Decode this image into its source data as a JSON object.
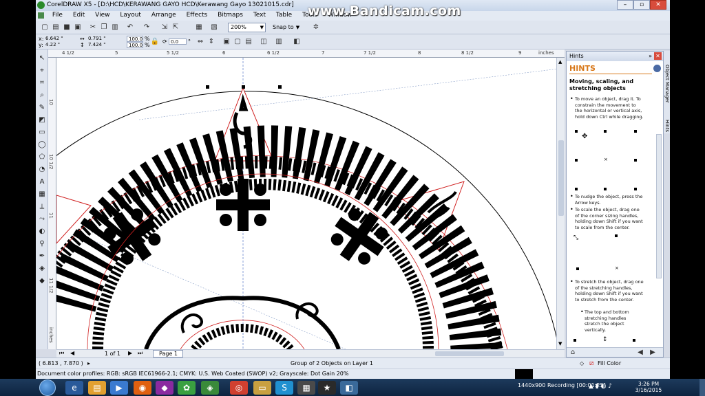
{
  "titlebar": {
    "app_title": "CorelDRAW X5 - [D:\\HCD\\KERAWANG GAYO HCD\\Kerawang Gayo 13021015.cdr]"
  },
  "menu": {
    "items": [
      "File",
      "Edit",
      "View",
      "Layout",
      "Arrange",
      "Effects",
      "Bitmaps",
      "Text",
      "Table",
      "Tools",
      "Window"
    ]
  },
  "toolbar": {
    "zoom": "200%",
    "snap_to": "Snap to"
  },
  "propbar": {
    "x": "6.642 \"",
    "y": "4.22 \"",
    "w": "0.791 \"",
    "h": "7.424 \"",
    "scale_x": "100.0",
    "scale_y": "100.0",
    "rotation": "0.0",
    "x_label": "x:",
    "y_label": "y:",
    "pct": "%",
    "deg": "°"
  },
  "ruler": {
    "h_ticks": [
      "4 1/2",
      "5",
      "5 1/2",
      "6",
      "6 1/2",
      "7",
      "7 1/2",
      "8",
      "8 1/2",
      "9"
    ],
    "units": "inches",
    "v_ticks": [
      "10",
      "10 1/2",
      "11",
      "11 1/2"
    ],
    "v_units": "inches"
  },
  "pagenav": {
    "page_counter": "1 of 1",
    "page_tab": "Page 1"
  },
  "status": {
    "coords": "( 6.813 , 7.870 )",
    "selection": "Group of 2 Objects on Layer 1",
    "color_profiles": "Document color profiles: RGB: sRGB IEC61966-2.1; CMYK: U.S. Web Coated (SWOP) v2; Grayscale: Dot Gain 20%",
    "fill_color": "Fill Color",
    "arrow": "▸"
  },
  "docker": {
    "title": "Hints",
    "hints_title": "HINTS",
    "heading": "Moving, scaling, and stretching objects",
    "hint_move": "To move an object, drag it. To constrain the movement to the horizontal or vertical axis, hold down Ctrl while dragging.",
    "hint_nudge": "To nudge the object, press the Arrow keys.",
    "hint_scale": "To scale the object, drag one of the corner sizing handles, holding down Shift if you want to scale from the center.",
    "hint_stretch": "To stretch the object, drag one of the stretching handles, holding down Shift if you want to stretch from the center.",
    "hint_stretch_sub": "The top and bottom stretching handles stretch the object vertically."
  },
  "sidetabs": [
    "Object Manager",
    "Hints"
  ],
  "palette": [
    "#ffffff",
    "#000000",
    "#00a0e0",
    "#0050c8",
    "#00c8ff",
    "#00b050",
    "#20c020",
    "#b0e000",
    "#fff000",
    "#ffc000",
    "#ff8000",
    "#e00000",
    "#c00060",
    "#e060a0",
    "#a040c0",
    "#8060e0",
    "#6080ff",
    "#80a0e0",
    "#a0b8d8",
    "#c0c8d0",
    "#e0e0e0",
    "#60a0a0",
    "#40c0a0",
    "#80e0c0",
    "#a0ffe0",
    "#008080"
  ],
  "watermark": "www.Bandicam.com",
  "recording": {
    "resolution": "1440x900",
    "text": "Recording [00:01:25]"
  },
  "clock": {
    "time": "3:26 PM",
    "date": "3/16/2015"
  }
}
